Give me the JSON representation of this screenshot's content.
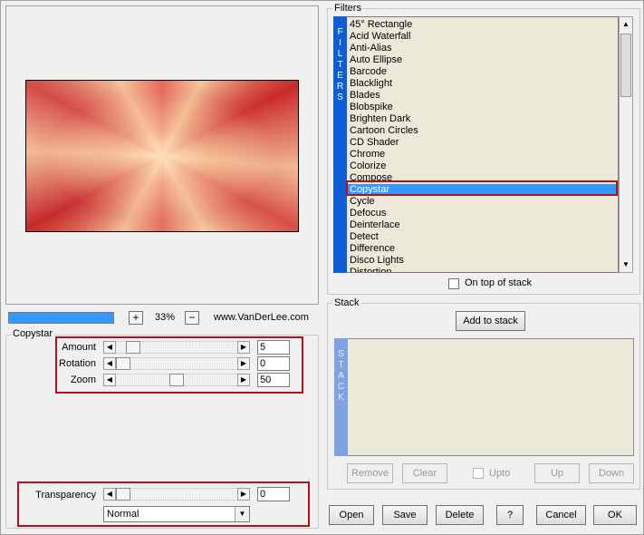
{
  "preview": {
    "zoom_out_label": "+",
    "zoom_value": "33%",
    "zoom_in_label": "−",
    "site": "www.VanDerLee.com",
    "progress": 1.0
  },
  "filters": {
    "group_title": "Filters",
    "bar_label": [
      "F",
      "I",
      "L",
      "T",
      "E",
      "R",
      "S"
    ],
    "items": [
      "45° Rectangle",
      "Acid Waterfall",
      "Anti-Alias",
      "Auto Ellipse",
      "Barcode",
      "Blacklight",
      "Blades",
      "Blobspike",
      "Brighten Dark",
      "Cartoon Circles",
      "CD Shader",
      "Chrome",
      "Colorize",
      "Compose",
      "Copystar",
      "Cycle",
      "Defocus",
      "Deinterlace",
      "Detect",
      "Difference",
      "Disco Lights",
      "Distortion"
    ],
    "selected": "Copystar",
    "on_top_label": "On top of stack"
  },
  "stack": {
    "group_title": "Stack",
    "bar_label": [
      "S",
      "T",
      "A",
      "C",
      "K"
    ],
    "add_label": "Add to stack",
    "remove_label": "Remove",
    "clear_label": "Clear",
    "upto_label": "Upto",
    "up_label": "Up",
    "down_label": "Down"
  },
  "params": {
    "group_title": "Copystar",
    "amount": {
      "label": "Amount",
      "value": "5",
      "level": 0.09
    },
    "rotation": {
      "label": "Rotation",
      "value": "0",
      "level": 0.0
    },
    "zoom": {
      "label": "Zoom",
      "value": "50",
      "level": 0.5
    },
    "transparency": {
      "label": "Transparency",
      "value": "0",
      "level": 0.0
    },
    "blend_mode": "Normal"
  },
  "footer": {
    "open": "Open",
    "save": "Save",
    "delete": "Delete",
    "help": "?",
    "cancel": "Cancel",
    "ok": "OK"
  },
  "colors": {
    "selection": "#3399ff",
    "filters_bar": "#0d5ed6",
    "stack_bar": "#7fa2e2",
    "highlight_box": "#b0121b"
  }
}
